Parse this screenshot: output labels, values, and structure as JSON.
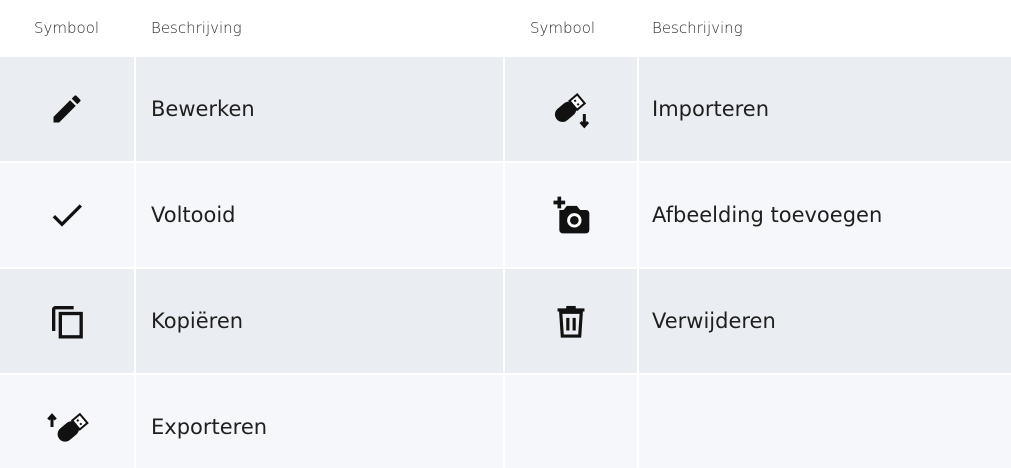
{
  "header": {
    "symbol": "Symbool",
    "description": "Beschrijving"
  },
  "left_rows": [
    {
      "icon": "pencil-icon",
      "label": "Bewerken"
    },
    {
      "icon": "checkmark-icon",
      "label": "Voltooid"
    },
    {
      "icon": "copy-icon",
      "label": "Kopiëren"
    },
    {
      "icon": "usb-export-icon",
      "label": "Exporteren"
    }
  ],
  "right_rows": [
    {
      "icon": "usb-import-icon",
      "label": "Importeren"
    },
    {
      "icon": "add-photo-icon",
      "label": "Afbeelding toevoegen"
    },
    {
      "icon": "trash-icon",
      "label": "Verwijderen"
    },
    {
      "icon": "",
      "label": ""
    }
  ],
  "colors": {
    "row_dark": "#eaedf2",
    "row_light": "#f5f7fa",
    "text": "#1f1f1f"
  }
}
